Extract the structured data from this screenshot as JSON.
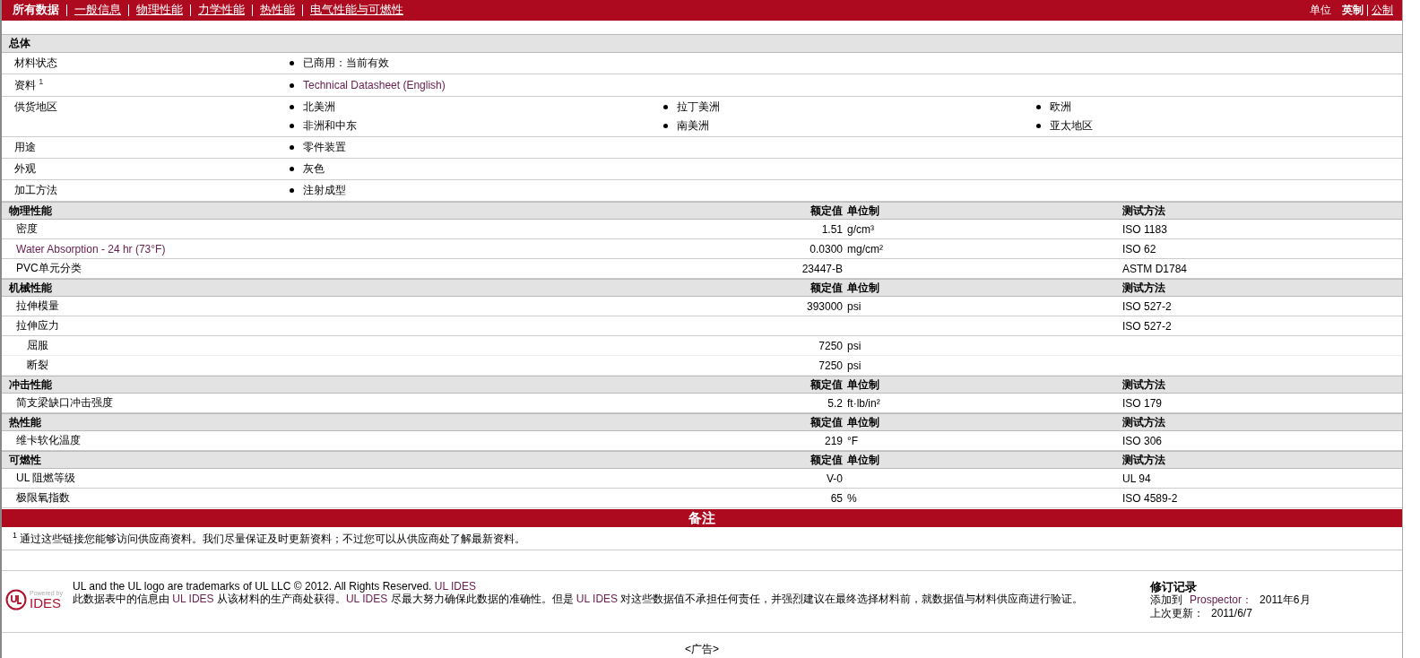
{
  "nav": {
    "tabs": [
      {
        "label": "所有数据",
        "selected": true
      },
      {
        "label": "一般信息",
        "selected": false
      },
      {
        "label": "物理性能",
        "selected": false
      },
      {
        "label": "力学性能",
        "selected": false
      },
      {
        "label": "热性能",
        "selected": false
      },
      {
        "label": "电气性能与可燃性",
        "selected": false
      }
    ],
    "units_label": "单位",
    "units": [
      {
        "label": "英制",
        "selected": true
      },
      {
        "label": "公制",
        "selected": false
      }
    ]
  },
  "general": {
    "title": "总体",
    "rows": [
      {
        "label": "材料状态",
        "items": [
          {
            "text": "已商用：当前有效",
            "link": false
          }
        ]
      },
      {
        "label": "资料 $^{1}$",
        "items": [
          {
            "text": "Technical Datasheet (English)",
            "link": true
          }
        ]
      },
      {
        "label": "供货地区",
        "items": [
          {
            "text": "北美洲",
            "link": false
          },
          {
            "text": "拉丁美洲",
            "link": false
          },
          {
            "text": "欧洲",
            "link": false
          },
          {
            "text": "非洲和中东",
            "link": false
          },
          {
            "text": "南美洲",
            "link": false
          },
          {
            "text": "亚太地区",
            "link": false
          }
        ]
      },
      {
        "label": "用途",
        "items": [
          {
            "text": "零件装置",
            "link": false
          }
        ]
      },
      {
        "label": "外观",
        "items": [
          {
            "text": "灰色",
            "link": false
          }
        ]
      },
      {
        "label": "加工方法",
        "items": [
          {
            "text": "注射成型",
            "link": false
          }
        ]
      }
    ]
  },
  "sections": [
    {
      "title": "物理性能",
      "value_header": "额定值",
      "unit_header": "单位制",
      "method_header": "测试方法",
      "rows": [
        {
          "label": "密度",
          "link": false,
          "value": "1.51",
          "unit": "g/cm³",
          "method": "ISO 1183"
        },
        {
          "label": "Water Absorption - 24 hr (73°F)",
          "link": true,
          "value": "0.0300",
          "unit": "mg/cm²",
          "method": "ISO 62"
        },
        {
          "label": "PVC单元分类",
          "link": false,
          "value": "23447-B",
          "method": "ASTM D1784"
        }
      ]
    },
    {
      "title": "机械性能",
      "value_header": "额定值",
      "unit_header": "单位制",
      "method_header": "测试方法",
      "rows": [
        {
          "label": "拉伸模量",
          "link": false,
          "value": "393000",
          "unit": "psi",
          "method": "ISO 527-2"
        },
        {
          "label": "拉伸应力",
          "link": false,
          "method": "ISO 527-2",
          "children": [
            {
              "label": "屈服",
              "link": false,
              "value": "7250",
              "unit": "psi"
            },
            {
              "label": "断裂",
              "link": false,
              "value": "7250",
              "unit": "psi"
            }
          ]
        }
      ]
    },
    {
      "title": "冲击性能",
      "value_header": "额定值",
      "unit_header": "单位制",
      "method_header": "测试方法",
      "rows": [
        {
          "label": "简支梁缺口冲击强度",
          "link": false,
          "value": "5.2",
          "unit": "ft·lb/in²",
          "method": "ISO 179"
        }
      ]
    },
    {
      "title": "热性能",
      "value_header": "额定值",
      "unit_header": "单位制",
      "method_header": "测试方法",
      "rows": [
        {
          "label": "维卡软化温度",
          "link": false,
          "value": "219",
          "unit": "°F",
          "method": "ISO 306"
        }
      ]
    },
    {
      "title": "可燃性",
      "value_header": "额定值",
      "unit_header": "单位制",
      "method_header": "测试方法",
      "rows": [
        {
          "label": "UL 阻燃等级",
          "link": false,
          "value": "V-0",
          "method": "UL 94"
        },
        {
          "label": "极限氧指数",
          "link": false,
          "value": "65",
          "unit": "%",
          "method": "ISO 4589-2"
        }
      ]
    }
  ],
  "notes": {
    "title": "备注",
    "items": [
      {
        "mark": "1",
        "text": "通过这些链接您能够访问供应商资料。我们尽量保证及时更新资料；不过您可以从供应商处了解最新资料。"
      }
    ]
  },
  "footer": {
    "logo_caption": "Powered by",
    "logo_text": "IDES",
    "trademark": [
      {
        "text": "UL and the UL logo are trademarks of UL LLC © 2012. All Rights Reserved. ",
        "kind": "text"
      },
      {
        "text": "UL IDES",
        "kind": "link"
      }
    ],
    "disclaimer": [
      {
        "text": "此数据表中的信息由 ",
        "kind": "text"
      },
      {
        "text": "UL IDES",
        "kind": "link"
      },
      {
        "text": " 从该材料的生产商处获得。",
        "kind": "text"
      },
      {
        "text": "UL IDES",
        "kind": "link"
      },
      {
        "text": " 尽最大努力确保此数据的准确性。但是 ",
        "kind": "text"
      },
      {
        "text": "UL IDES",
        "kind": "link"
      },
      {
        "text": " 对这些数据值不承担任何责任，并强烈建议在最终选择材料前，就数据值与材料供应商进行验证。",
        "kind": "text"
      }
    ],
    "revision": {
      "title": "修订记录",
      "added_label": "添加到",
      "added_link": "Prospector：",
      "added_date": "2011年6月",
      "updated_label": "上次更新：",
      "updated_date": "2011/6/7"
    }
  },
  "ad": "<广告>"
}
